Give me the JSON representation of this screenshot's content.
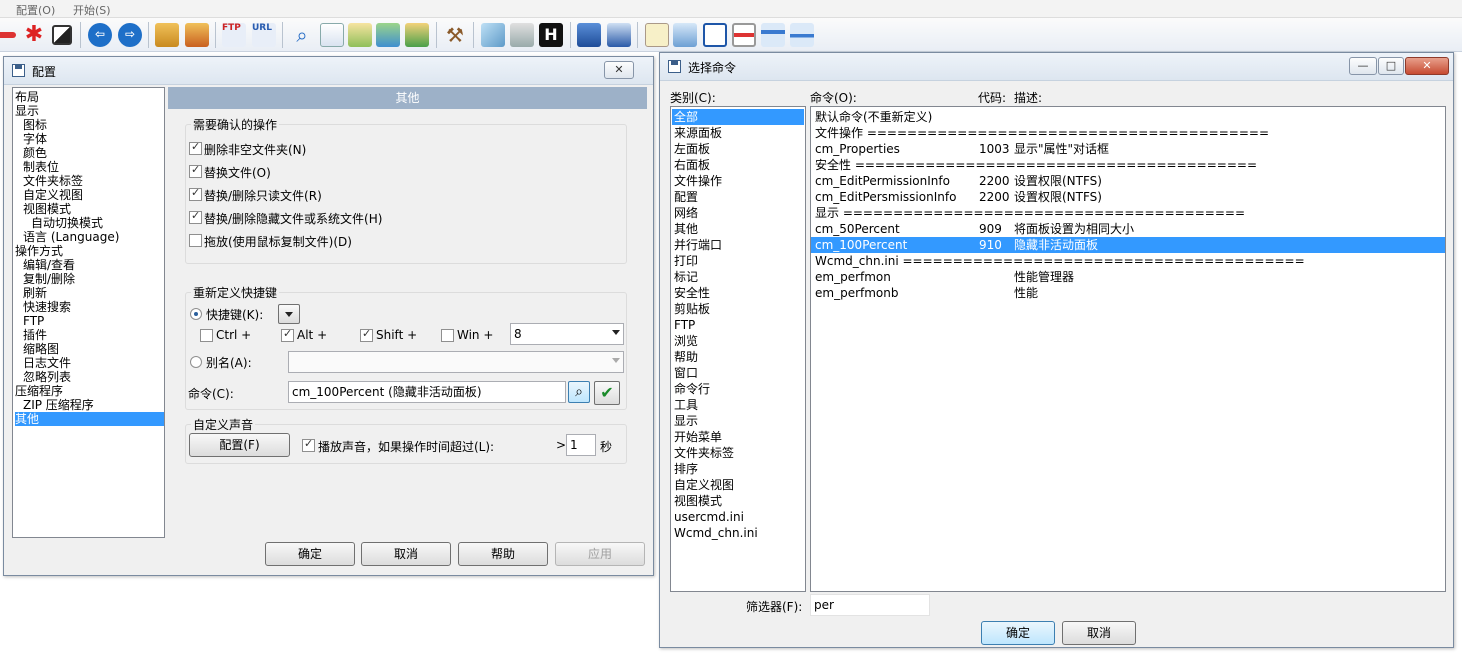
{
  "menubar": [
    "配置(O)",
    "开始(S)"
  ],
  "config": {
    "title": "配置",
    "close": "✕",
    "tree": [
      {
        "label": "布局",
        "indent": 0
      },
      {
        "label": "显示",
        "indent": 0
      },
      {
        "label": "图标",
        "indent": 1
      },
      {
        "label": "字体",
        "indent": 1
      },
      {
        "label": "颜色",
        "indent": 1
      },
      {
        "label": "制表位",
        "indent": 1
      },
      {
        "label": "文件夹标签",
        "indent": 1
      },
      {
        "label": "自定义视图",
        "indent": 1
      },
      {
        "label": "视图模式",
        "indent": 1
      },
      {
        "label": "自动切换模式",
        "indent": 2
      },
      {
        "label": "语言 (Language)",
        "indent": 1
      },
      {
        "label": "操作方式",
        "indent": 0
      },
      {
        "label": "编辑/查看",
        "indent": 1
      },
      {
        "label": "复制/删除",
        "indent": 1
      },
      {
        "label": "刷新",
        "indent": 1
      },
      {
        "label": "快速搜索",
        "indent": 1
      },
      {
        "label": "FTP",
        "indent": 1
      },
      {
        "label": "插件",
        "indent": 1
      },
      {
        "label": "缩略图",
        "indent": 1
      },
      {
        "label": "日志文件",
        "indent": 1
      },
      {
        "label": "忽略列表",
        "indent": 1
      },
      {
        "label": "压缩程序",
        "indent": 0
      },
      {
        "label": "ZIP 压缩程序",
        "indent": 1
      },
      {
        "label": "其他",
        "indent": 0,
        "selected": true
      }
    ],
    "panel_header": "其他",
    "confirm_group": "需要确认的操作",
    "confirm_items": [
      {
        "label": "删除非空文件夹(N)",
        "checked": true
      },
      {
        "label": "替换文件(O)",
        "checked": true
      },
      {
        "label": "替换/删除只读文件(R)",
        "checked": true
      },
      {
        "label": "替换/删除隐藏文件或系统文件(H)",
        "checked": true
      },
      {
        "label": "拖放(使用鼠标复制文件)(D)",
        "checked": false
      }
    ],
    "hotkey_group": "重新定义快捷键",
    "hotkey_label": "快捷键(K):",
    "modifiers": [
      {
        "label": "Ctrl +",
        "checked": false
      },
      {
        "label": "Alt +",
        "checked": true
      },
      {
        "label": "Shift +",
        "checked": true
      },
      {
        "label": "Win +",
        "checked": false
      }
    ],
    "key_value": "8",
    "alias_label": "别名(A):",
    "alias_value": "",
    "command_label": "命令(C):",
    "command_value": "cm_100Percent (隐藏非活动面板)",
    "sound_group": "自定义声音",
    "sound_button": "配置(F)",
    "sound_check_label": "播放声音，如果操作时间超过(L):",
    "sound_gt": ">",
    "sound_value": "1",
    "sound_unit": "秒",
    "buttons": {
      "ok": "确定",
      "cancel": "取消",
      "help": "帮助",
      "apply": "应用"
    }
  },
  "select_cmd": {
    "title": "选择命令",
    "category_label": "类别(C):",
    "categories": [
      "全部",
      "来源面板",
      "左面板",
      "右面板",
      "文件操作",
      "配置",
      "网络",
      "其他",
      "并行端口",
      "打印",
      "标记",
      "安全性",
      "剪贴板",
      "FTP",
      "浏览",
      "帮助",
      "窗口",
      "命令行",
      "工具",
      "显示",
      "开始菜单",
      "文件夹标签",
      "排序",
      "自定义视图",
      "视图模式",
      "usercmd.ini",
      "Wcmd_chn.ini"
    ],
    "col_command": "命令(O):",
    "col_code": "代码:",
    "col_desc": "描述:",
    "commands": [
      {
        "name": "默认命令(不重新定义)",
        "code": "",
        "desc": ""
      },
      {
        "name": "文件操作 ========================================",
        "code": "",
        "desc": ""
      },
      {
        "name": "cm_Properties",
        "code": "1003",
        "desc": "显示\"属性\"对话框"
      },
      {
        "name": "安全性 ========================================",
        "code": "",
        "desc": ""
      },
      {
        "name": "cm_EditPermissionInfo",
        "code": "2200",
        "desc": "设置权限(NTFS)"
      },
      {
        "name": "cm_EditPersmissionInfo",
        "code": "2200",
        "desc": "设置权限(NTFS)"
      },
      {
        "name": "显示 ========================================",
        "code": "",
        "desc": ""
      },
      {
        "name": "cm_50Percent",
        "code": "909",
        "desc": "将面板设置为相同大小"
      },
      {
        "name": "cm_100Percent",
        "code": "910",
        "desc": "隐藏非活动面板",
        "selected": true
      },
      {
        "name": "Wcmd_chn.ini ========================================",
        "code": "",
        "desc": ""
      },
      {
        "name": "em_perfmon",
        "code": "",
        "desc": "性能管理器"
      },
      {
        "name": "em_perfmonb",
        "code": "",
        "desc": "性能"
      }
    ],
    "filter_label": "筛选器(F):",
    "filter_value": "per",
    "ok": "确定",
    "cancel": "取消",
    "win_min": "—",
    "win_max": "□",
    "win_close": "✕"
  }
}
